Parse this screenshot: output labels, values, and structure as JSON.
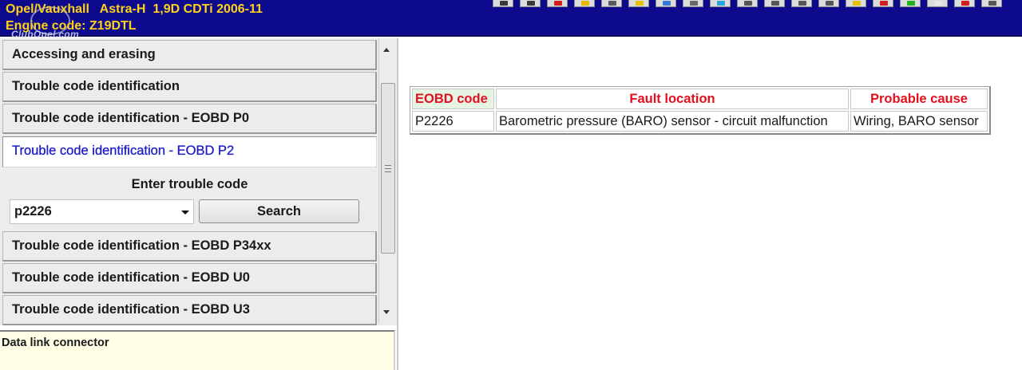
{
  "header": {
    "vehicle": "Opel/Vauxhall   Astra-H  1,9D CDTi 2006-11",
    "engine": "Engine code: Z19DTL",
    "watermark": "ClubOpel.com"
  },
  "toolbar": {
    "icons": [
      "cursor-icon",
      "pointer-icon",
      "red-tool-icon",
      "yellow-tool-icon",
      "document-icon",
      "folder-icon",
      "globe-icon",
      "disk-icon",
      "image-icon",
      "printer-icon",
      "network-icon",
      "printer-setup-icon",
      "edit-icon",
      "yellow-check-icon",
      "red-check-icon",
      "green-check-icon",
      "window-icon",
      "close-window-icon",
      "help-icon"
    ],
    "colors": [
      "#3a3a3a",
      "#3a3a3a",
      "#d21e1e",
      "#e6b800",
      "#5a5a5a",
      "#e6c200",
      "#3a7ad6",
      "#6a6a6a",
      "#2aa7d8",
      "#555555",
      "#555555",
      "#555555",
      "#555555",
      "#e6c200",
      "#d21e1e",
      "#22b022",
      "#e6e6e6",
      "#d21e1e",
      "#555555"
    ]
  },
  "menu": {
    "items": [
      {
        "label": "Accessing and erasing"
      },
      {
        "label": "Trouble code identification"
      },
      {
        "label": "Trouble code identification - EOBD P0"
      },
      {
        "label": "Trouble code identification - EOBD P2"
      },
      {
        "label": "Trouble code identification - EOBD P34xx"
      },
      {
        "label": "Trouble code identification - EOBD U0"
      },
      {
        "label": "Trouble code identification - EOBD U3"
      }
    ],
    "active_color": "#1a1ac8"
  },
  "entry": {
    "label": "Enter trouble code",
    "code_value": "p2226",
    "search_label": "Search"
  },
  "info": {
    "text": "Data link connector"
  },
  "results": {
    "headers": {
      "code": "EOBD code",
      "location": "Fault location",
      "cause": "Probable cause"
    },
    "rows": [
      {
        "code": "P2226",
        "location": "Barometric pressure (BARO) sensor - circuit malfunction",
        "cause": "Wiring, BARO sensor"
      }
    ],
    "header_color": "#e3101e"
  }
}
